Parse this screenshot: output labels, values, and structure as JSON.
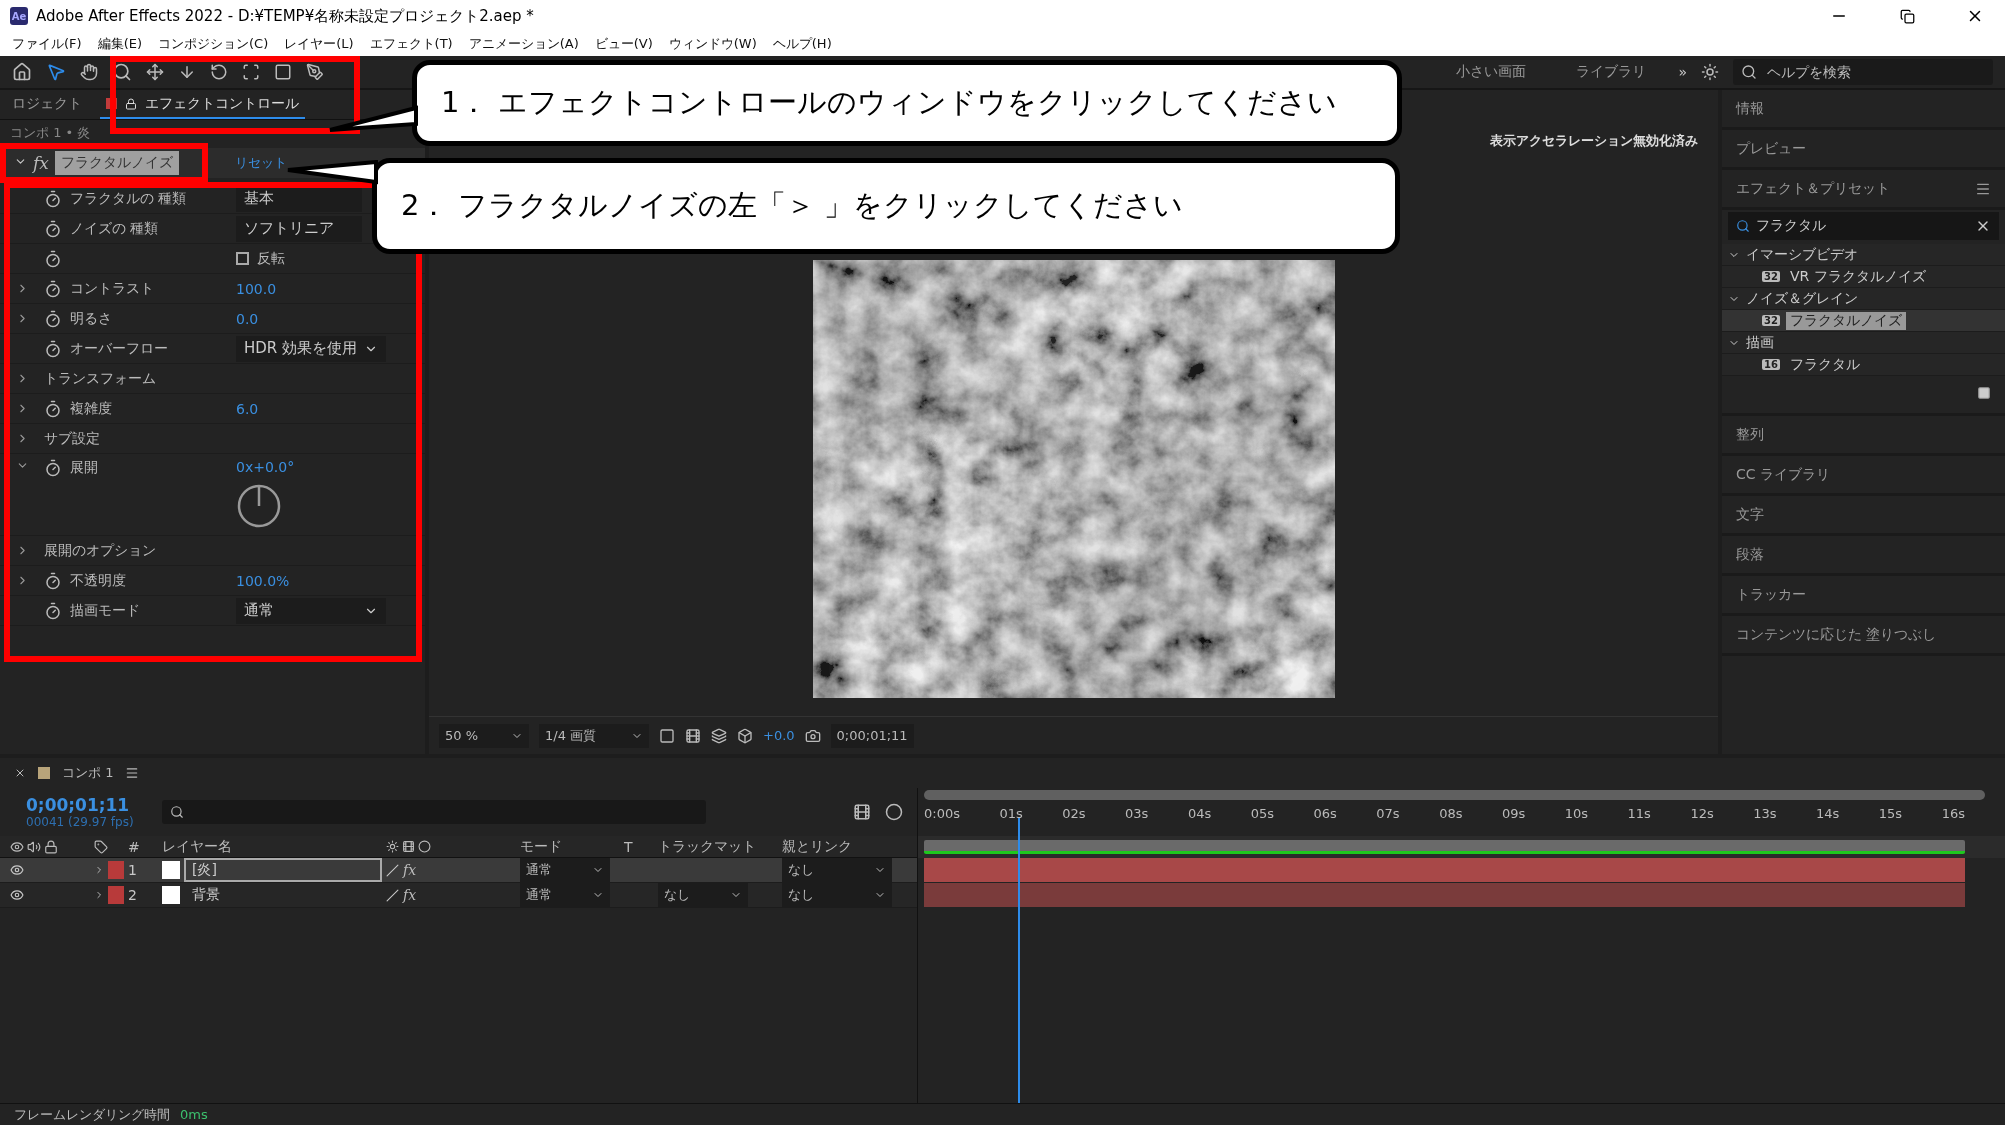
{
  "window": {
    "app_icon": "Ae",
    "title": "Adobe After Effects 2022 - D:¥TEMP¥名称未設定プロジェクト2.aep *"
  },
  "menu": [
    "ファイル(F)",
    "編集(E)",
    "コンポジション(C)",
    "レイヤー(L)",
    "エフェクト(T)",
    "アニメーション(A)",
    "ビュー(V)",
    "ウィンドウ(W)",
    "ヘルプ(H)"
  ],
  "toolbar": {
    "workspaces": [
      "小さい画面",
      "ライブラリ"
    ],
    "more": "»",
    "help_search": {
      "placeholder": "ヘルプを検索"
    }
  },
  "left_panel": {
    "tabs": [
      {
        "label": "ロジェクト",
        "selected": false
      },
      {
        "label": "エフェクトコントロール",
        "selected": true
      }
    ],
    "breadcrumb": "コンポ 1 • 炎",
    "effect": {
      "badge": "fx",
      "name": "フラクタルノイズ",
      "expanded": true,
      "reset": "リセット"
    },
    "properties": [
      {
        "kind": "field",
        "label": "フラクタルの 種類",
        "value": "基本"
      },
      {
        "kind": "field",
        "label": "ノイズの 種類",
        "value": "ソフトリニア"
      },
      {
        "kind": "checkbox",
        "checkbox_label": "反転",
        "checked": false
      },
      {
        "kind": "number",
        "label": "コントラスト",
        "value": "100.0",
        "expanded": false
      },
      {
        "kind": "number",
        "label": "明るさ",
        "value": "0.0",
        "expanded": false
      },
      {
        "kind": "select",
        "label": "オーバーフロー",
        "value": "HDR 効果を使用"
      },
      {
        "kind": "group",
        "label": "トランスフォーム",
        "expanded": false
      },
      {
        "kind": "number",
        "label": "複雑度",
        "value": "6.0",
        "expanded": false
      },
      {
        "kind": "group",
        "label": "サブ設定",
        "expanded": false
      },
      {
        "kind": "dial",
        "label": "展開",
        "value": "0x+0.0°",
        "expanded": true
      },
      {
        "kind": "group",
        "label": "展開のオプション",
        "expanded": false
      },
      {
        "kind": "number",
        "label": "不透明度",
        "value": "100.0%",
        "expanded": false
      },
      {
        "kind": "select",
        "label": "描画モード",
        "value": "通常"
      }
    ]
  },
  "viewer": {
    "notice": "表示アクセラレーション無効化済み",
    "footer": {
      "zoom": "50 %",
      "resolution": "1/4 画質",
      "exposure": "+0.0",
      "timecode": "0;00;01;11"
    }
  },
  "right_panel": {
    "panels_above": [
      "情報",
      "プレビュー"
    ],
    "effects": {
      "title": "エフェクト＆プリセット",
      "search": "フラクタル",
      "tree": [
        {
          "label": "イマーシブビデオ",
          "expanded": true,
          "children": [
            {
              "label": "VR フラクタルノイズ",
              "bits": "32",
              "selected": false
            }
          ]
        },
        {
          "label": "ノイズ＆グレイン",
          "expanded": true,
          "children": [
            {
              "label": "フラクタルノイズ",
              "bits": "32",
              "selected": true
            }
          ]
        },
        {
          "label": "描画",
          "expanded": true,
          "children": [
            {
              "label": "フラクタル",
              "bits": "16",
              "selected": false
            }
          ]
        }
      ]
    },
    "panels_below": [
      "整列",
      "CC ライブラリ",
      "文字",
      "段落",
      "トラッカー",
      "コンテンツに応じた 塗りつぶし"
    ]
  },
  "timeline": {
    "tab": "コンポ 1",
    "timecode": "0;00;01;11",
    "frames": "00041 (29.97 fps)",
    "columns": {
      "number": "#",
      "name": "レイヤー名",
      "mode": "モード",
      "t": "T",
      "track_matte": "トラックマット",
      "parent": "親とリンク"
    },
    "layers": [
      {
        "number": "1",
        "name": "[炎]",
        "selected": true,
        "effects_switch": "fx",
        "mode": "通常",
        "parent": "なし"
      },
      {
        "number": "2",
        "name": "背景",
        "selected": false,
        "effects_switch": "fx",
        "mode": "通常",
        "track_matte": "なし",
        "parent": "なし"
      }
    ],
    "ruler": [
      "0:00s",
      "01s",
      "02s",
      "03s",
      "04s",
      "05s",
      "06s",
      "07s",
      "08s",
      "09s",
      "10s",
      "11s",
      "12s",
      "13s",
      "14s",
      "15s",
      "16s"
    ],
    "playhead": {
      "level": 0.09
    }
  },
  "status_bar": {
    "label": "フレームレンダリング時間",
    "value": "0ms"
  },
  "callouts": [
    {
      "text": "1． エフェクトコントロールのウィンドウをクリックしてください"
    },
    {
      "text": "2． フラクタルノイズの左「＞ 」をクリックしてください"
    }
  ]
}
